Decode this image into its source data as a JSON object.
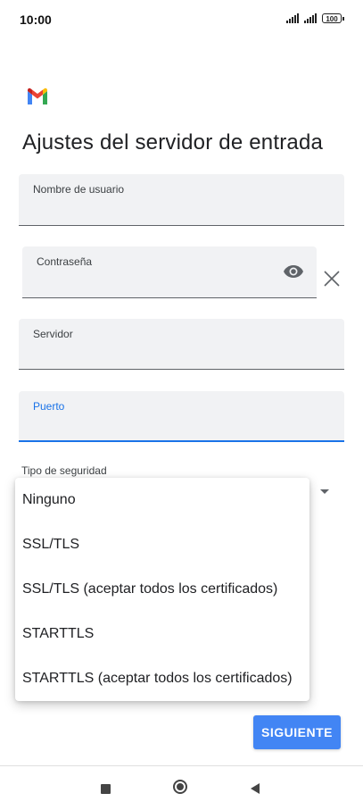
{
  "status_bar": {
    "time": "10:00",
    "battery": "100"
  },
  "app": {
    "logo": "gmail-logo",
    "colors": {
      "accent": "#1a73e8",
      "button": "#4285f4",
      "field_bg": "#f1f2f4"
    }
  },
  "page": {
    "title": "Ajustes del servidor de entrada"
  },
  "fields": {
    "username": {
      "label": "Nombre de usuario",
      "value": ""
    },
    "password": {
      "label": "Contraseña",
      "value": "",
      "icon": "eye-icon"
    },
    "server": {
      "label": "Servidor",
      "value": ""
    },
    "port": {
      "label": "Puerto",
      "value": "",
      "focused": true
    }
  },
  "security": {
    "label": "Tipo de seguridad",
    "options": [
      "Ninguno",
      "SSL/TLS",
      "SSL/TLS (aceptar todos los certificados)",
      "STARTTLS",
      "STARTTLS (aceptar todos los certificados)"
    ]
  },
  "actions": {
    "next_label": "SIGUIENTE"
  },
  "nav": {
    "icons": [
      "recent-apps-icon",
      "home-icon",
      "back-icon"
    ]
  }
}
